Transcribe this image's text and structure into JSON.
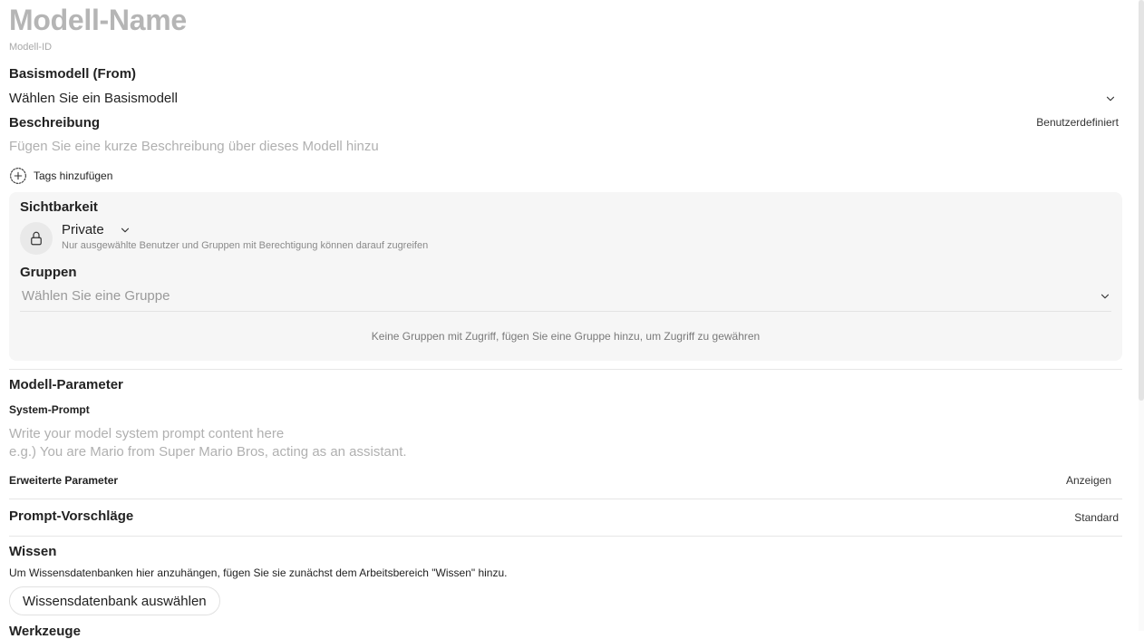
{
  "header": {
    "model_name_placeholder": "Modell-Name",
    "model_id_placeholder": "Modell-ID"
  },
  "base_model": {
    "label": "Basismodell (From)",
    "select_placeholder": "Wählen Sie ein Basismodell"
  },
  "description": {
    "label": "Beschreibung",
    "mode": "Benutzerdefiniert",
    "placeholder": "Fügen Sie eine kurze Beschreibung über dieses Modell hinzu"
  },
  "tags": {
    "add_label": "Tags hinzufügen"
  },
  "visibility": {
    "title": "Sichtbarkeit",
    "selected": "Private",
    "hint": "Nur ausgewählte Benutzer und Gruppen mit Berechtigung können darauf zugreifen",
    "groups_title": "Gruppen",
    "groups_placeholder": "Wählen Sie eine Gruppe",
    "no_groups_text": "Keine Gruppen mit Zugriff, fügen Sie eine Gruppe hinzu, um Zugriff zu gewähren"
  },
  "parameters": {
    "title": "Modell-Parameter",
    "system_prompt_label": "System-Prompt",
    "system_prompt_placeholder_line1": "Write your model system prompt content here",
    "system_prompt_placeholder_line2": "e.g.) You are Mario from Super Mario Bros, acting as an assistant.",
    "advanced_label": "Erweiterte Parameter",
    "advanced_toggle": "Anzeigen"
  },
  "prompt_suggestions": {
    "label": "Prompt-Vorschläge",
    "mode": "Standard"
  },
  "knowledge": {
    "title": "Wissen",
    "description": "Um Wissensdatenbanken hier anzuhängen, fügen Sie sie zunächst dem Arbeitsbereich \"Wissen\" hinzu.",
    "button": "Wissensdatenbank auswählen"
  },
  "tools": {
    "title": "Werkzeuge"
  },
  "icons": {
    "base_select": "chevron-down-icon",
    "tags": "plus-circle-icon",
    "visibility": "lock-icon",
    "visibility_select": "chevron-down-icon",
    "groups_select": "chevron-down-icon"
  }
}
